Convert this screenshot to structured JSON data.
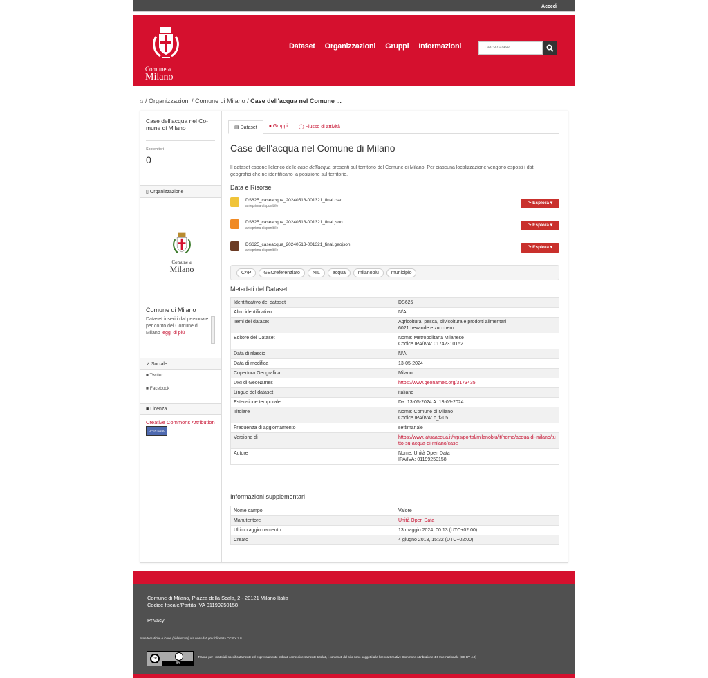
{
  "topbar": {
    "login": "Accedi"
  },
  "brand": {
    "line1": "Comune",
    "line1b": "di",
    "line2": "Milano"
  },
  "nav": {
    "items": [
      "Dataset",
      "Organizzazioni",
      "Gruppi",
      "Informazioni"
    ]
  },
  "search": {
    "placeholder": "Cerca dataset..."
  },
  "breadcrumb": {
    "home_icon": "home-icon",
    "sep1": "/",
    "org": "Organizzazioni",
    "sep2": "/",
    "org_name": "Comune di Milano",
    "sep3": "/",
    "current": "Case dell'acqua nel Comune ..."
  },
  "sidebar": {
    "title": "Case dell'acqua nel Co­mune di Milano",
    "followers_label": "Sostenitori",
    "followers_value": "0",
    "org_header": "Organizzazione",
    "org_name": "Comune di Milano",
    "org_desc": "Dataset inseriti dal personale per conto del Comune di Milano",
    "org_more": "leggi di più",
    "social_header": "Sociale",
    "twitter": "Twitter",
    "facebook": "Facebook",
    "license_header": "Licenza",
    "license": "Creative Commons Attribution",
    "open_data_badge": "OPEN DATA"
  },
  "tabs": [
    "Dataset",
    "Gruppi",
    "Flusso di attività"
  ],
  "dataset": {
    "title": "Case dell'acqua nel Comune di Milano",
    "desc_pre": "Il dataset espone l'elenco delle ",
    "desc_em": "case dell'acqua",
    "desc_post": " presenti sul territorio del Comune di Milano. Per ciascuna localizzazione vengono esposti i dati geografici che ne identificano la posizione sul territorio.",
    "resources_title": "Data e Risorse",
    "resources": [
      {
        "name": "DS625_caseacqua_20240513-001321_final.csv",
        "sub": "anteprima disponibile",
        "format": "CSV",
        "color": "#f0c43a"
      },
      {
        "name": "DS625_caseacqua_20240513-001321_final.json",
        "sub": "anteprima disponibile",
        "format": "JSON",
        "color": "#f08a24"
      },
      {
        "name": "DS625_caseacqua_20240513-001321_final.geojson",
        "sub": "anteprima disponibile",
        "format": "GEOJSON",
        "color": "#6b3b24"
      }
    ],
    "explore_label": "Esplora",
    "tags": [
      "CAP",
      "GEOreferenziato",
      "NIL",
      "acqua",
      "milanoblu",
      "municipio"
    ],
    "meta_title": "Metadati del Dataset",
    "meta": [
      {
        "k": "Identificativo del dataset",
        "v": "DS625"
      },
      {
        "k": "Altro identificativo",
        "v": "N/A"
      },
      {
        "k": "Temi del dataset",
        "v": "Agricoltura, pesca, silvicoltura e prodotti alimentari",
        "v2": "6021 bevande e zucchero"
      },
      {
        "k": "Editore del Dataset",
        "v": "Nome: Metropolitana Milanese",
        "v2": "Codice IPA/IVA: 01742310152"
      },
      {
        "k": "Data di rilascio",
        "v": "N/A"
      },
      {
        "k": "Data di modifica",
        "v": "13-05-2024"
      },
      {
        "k": "Copertura Geografica",
        "v": "Milano"
      },
      {
        "k": "URI di GeoNames",
        "v": "https://www.geonames.org/3173435"
      },
      {
        "k": "Lingue del dataset",
        "v": "italiano"
      },
      {
        "k": "Estensione temporale",
        "v": "Da: 13-05-2024 A: 13-05-2024"
      },
      {
        "k": "Titolare",
        "v": "Nome: Comune di Milano",
        "v2": "Codice IPA/IVA: c_f205"
      },
      {
        "k": "Frequenza di aggiornamento",
        "v": "settimanale"
      },
      {
        "k": "Versione di",
        "v": "https://www.latuaacqua.it/wps/portal/milanoblu/it/home/acqua-di-milano/tutto-su-acqua-di-milano/case"
      },
      {
        "k": "Autore",
        "v": "Nome: Unità Open Data",
        "v2": "IPA/IVA: 01199250158"
      }
    ],
    "extra_title": "Informazioni supplementari",
    "extra": [
      {
        "k": "Nome campo",
        "v": "Valore"
      },
      {
        "k": "Manutentore",
        "v": "Unità Open Data"
      },
      {
        "k": "Ultimo aggiornamento",
        "v": "13 maggio 2024, 00:13 (UTC+02:00)"
      },
      {
        "k": "Creato",
        "v": "4 giugno 2018, 15:32 (UTC+02:00)"
      }
    ]
  },
  "footer": {
    "address": "Comune di Milano, Piazza della Scala, 2 - 20121 Milano Italia",
    "fiscal": "Codice fiscale/Partita IVA 01199250158",
    "privacy": "Privacy",
    "icons_credit": "Aree tematiche e icone (rielaborate) via www.dati.gov.it licenza CC-BY 3.0",
    "license_note": "Tranne per i materiali specificatamente ed espressamente indicati come diversamente tutelati, i contenuti del sito sono soggetti alla licenza Creative Commons Attribuzione 4.0 Internazionale (CC BY 4.0)",
    "cc_label": "cc",
    "by_label": "BY"
  },
  "colors": {
    "brand": "#d5102e",
    "link": "#c6102f",
    "button": "#c9302c",
    "topbar": "#4b4b4b",
    "footer": "#505050"
  }
}
